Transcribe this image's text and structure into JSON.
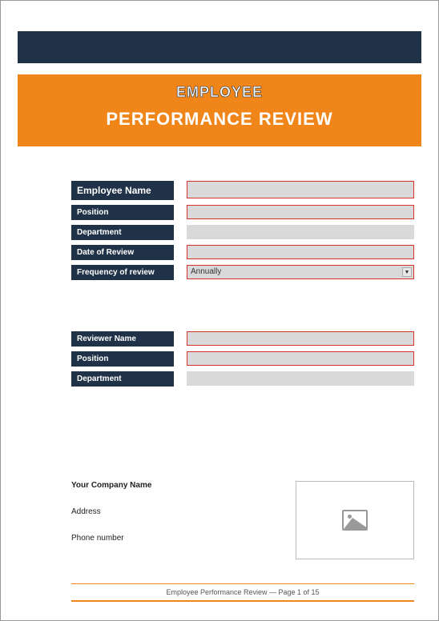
{
  "header": {
    "title_line1": "EMPLOYEE",
    "title_line2": "PERFORMANCE REVIEW"
  },
  "employee": {
    "name_label": "Employee Name",
    "position_label": "Position",
    "department_label": "Department",
    "date_label": "Date of Review",
    "frequency_label": "Frequency of review",
    "frequency_value": "Annually"
  },
  "reviewer": {
    "name_label": "Reviewer Name",
    "position_label": "Position",
    "department_label": "Department"
  },
  "company": {
    "name": "Your Company Name",
    "address": "Address",
    "phone": "Phone number"
  },
  "footer": {
    "text": "Employee Performance Review — Page 1 of 15"
  }
}
